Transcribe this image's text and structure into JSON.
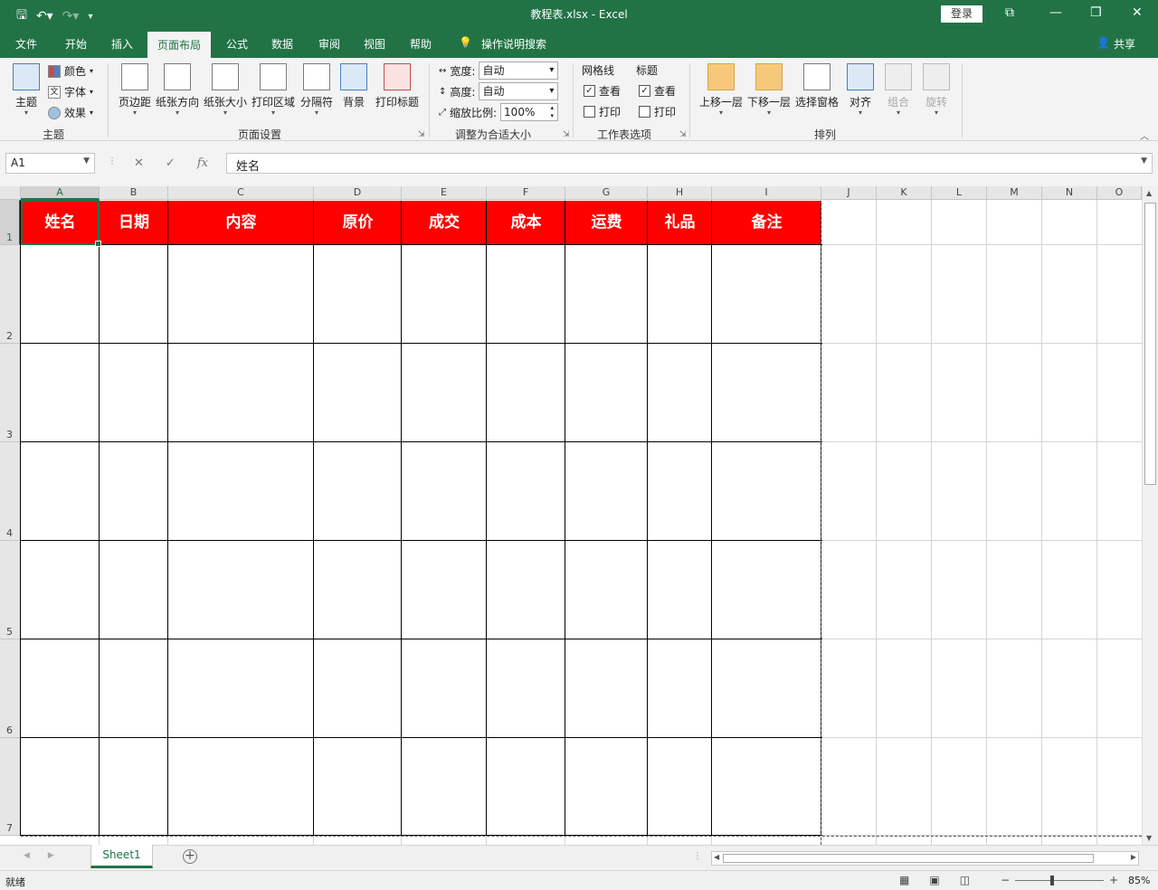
{
  "titlebar": {
    "title": "教程表.xlsx  -  Excel",
    "login": "登录",
    "save_icon": "save-icon",
    "undo_icon": "undo-icon",
    "redo_icon": "redo-icon"
  },
  "tabs": [
    "文件",
    "开始",
    "插入",
    "页面布局",
    "公式",
    "数据",
    "审阅",
    "视图",
    "帮助"
  ],
  "active_tab": "页面布局",
  "tell_me": "操作说明搜索",
  "share": "共享",
  "ribbon": {
    "theme_group": {
      "label": "主题",
      "theme_btn": "主题",
      "colors": "颜色",
      "fonts": "字体",
      "effects": "效果"
    },
    "page_setup": {
      "label": "页面设置",
      "margins": "页边距",
      "orientation": "纸张方向",
      "size": "纸张大小",
      "print_area": "打印区域",
      "breaks": "分隔符",
      "background": "背景",
      "print_titles": "打印标题"
    },
    "scale": {
      "label": "调整为合适大小",
      "width_label": "宽度:",
      "width_value": "自动",
      "height_label": "高度:",
      "height_value": "自动",
      "scale_label": "缩放比例:",
      "scale_value": "100%"
    },
    "sheet_options": {
      "label": "工作表选项",
      "gridlines": "网格线",
      "headings": "标题",
      "view": "查看",
      "print": "打印",
      "gridlines_view": true,
      "gridlines_print": false,
      "headings_view": true,
      "headings_print": false
    },
    "arrange": {
      "label": "排列",
      "bring_forward": "上移一层",
      "send_backward": "下移一层",
      "selection_pane": "选择窗格",
      "align": "对齐",
      "group": "组合",
      "rotate": "旋转"
    }
  },
  "formula_bar": {
    "name_box": "A1",
    "content": "姓名",
    "fx": "fx"
  },
  "columns": [
    "A",
    "B",
    "C",
    "D",
    "E",
    "F",
    "G",
    "H",
    "I",
    "J",
    "K",
    "L",
    "M",
    "N",
    "O"
  ],
  "rows": [
    "1",
    "2",
    "3",
    "4",
    "5",
    "6",
    "7"
  ],
  "header_cells": [
    "姓名",
    "日期",
    "内容",
    "原价",
    "成交",
    "成本",
    "运费",
    "礼品",
    "备注"
  ],
  "header_fill": "#ff0000",
  "sheet_tab": "Sheet1",
  "status": {
    "ready": "就绪",
    "zoom": "85%"
  },
  "accent": "#217346"
}
